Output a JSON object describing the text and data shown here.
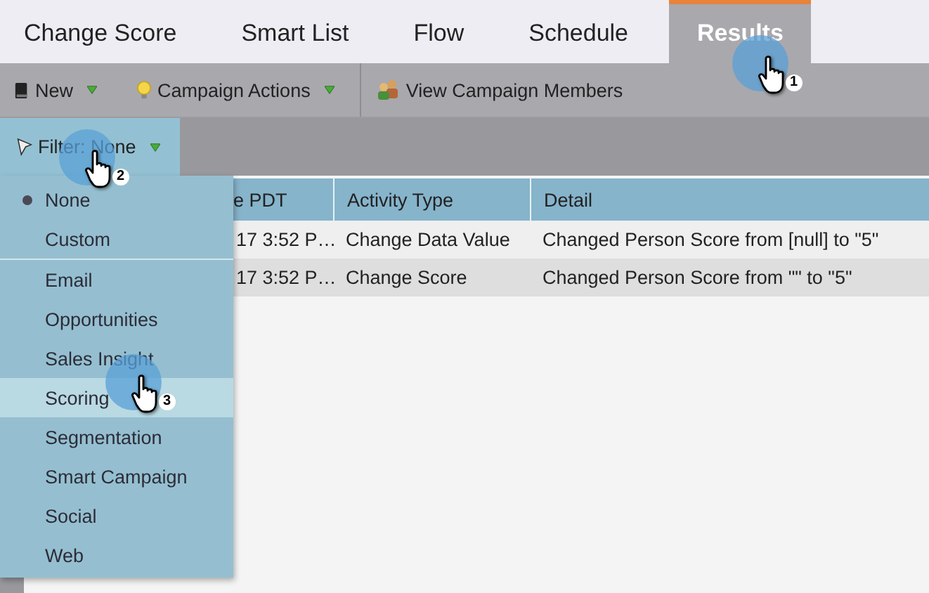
{
  "tabs": [
    {
      "label": "Change Score",
      "selected": false
    },
    {
      "label": "Smart List",
      "selected": false
    },
    {
      "label": "Flow",
      "selected": false
    },
    {
      "label": "Schedule",
      "selected": false
    },
    {
      "label": "Results",
      "selected": true,
      "callout": "1"
    }
  ],
  "toolbar": [
    {
      "label": "New",
      "kind": "book",
      "dropdown": true
    },
    {
      "label": "Campaign Actions",
      "kind": "bulb",
      "dropdown": true
    },
    {
      "label": "View Campaign Members",
      "kind": "people",
      "dropdown": false
    }
  ],
  "filter": {
    "label": "Filter: None",
    "callout": "2"
  },
  "filter_menu": [
    {
      "label": "None",
      "selected": true
    },
    {
      "label": "Custom",
      "selected": false,
      "divider_after": true
    },
    {
      "label": "Email",
      "selected": false
    },
    {
      "label": "Opportunities",
      "selected": false
    },
    {
      "label": "Sales Insight",
      "selected": false
    },
    {
      "label": "Scoring",
      "selected": false,
      "hovered": true,
      "callout": "3"
    },
    {
      "label": "Segmentation",
      "selected": false
    },
    {
      "label": "Smart Campaign",
      "selected": false
    },
    {
      "label": "Social",
      "selected": false
    },
    {
      "label": "Web",
      "selected": false
    }
  ],
  "table": {
    "columns": [
      "e PDT",
      "Activity Type",
      "Detail"
    ],
    "rows": [
      [
        "17 3:52 P…",
        "Change Data Value",
        "Changed Person Score from [null] to \"5\""
      ],
      [
        "17 3:52 P…",
        "Change Score",
        "Changed Person Score from \"\" to \"5\""
      ]
    ]
  }
}
